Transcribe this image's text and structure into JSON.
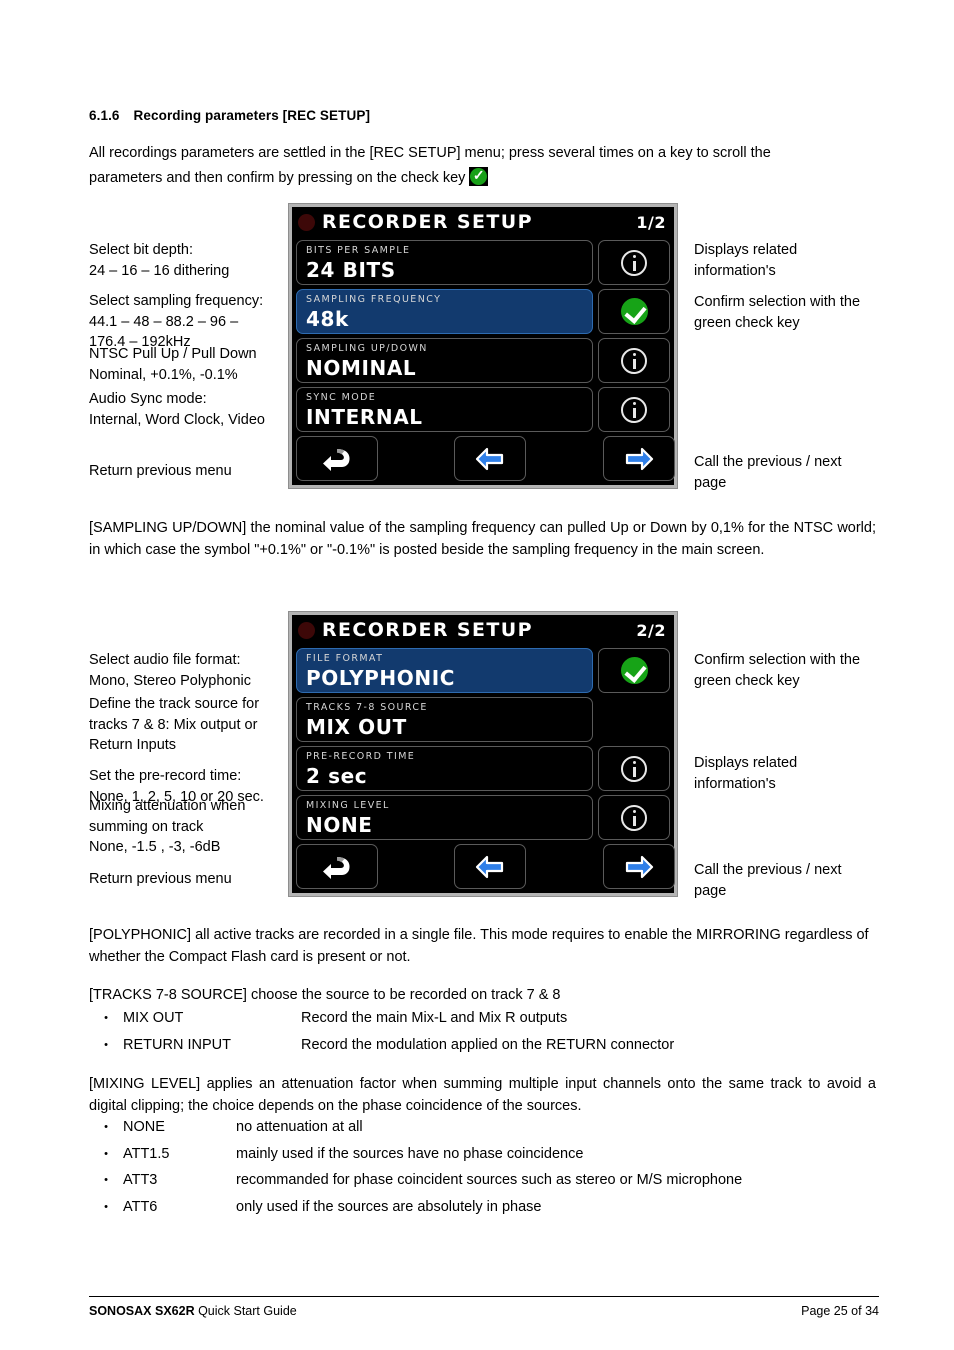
{
  "section": {
    "number": "6.1.6",
    "title": "Recording parameters [REC SETUP]"
  },
  "intro": {
    "line1": "All recordings parameters are settled in the [REC SETUP] menu; press several times on a key to scroll the",
    "line2": "parameters and then confirm by pressing on the check key",
    "check_icon": "green-check-icon"
  },
  "screen1": {
    "title": "RECORDER SETUP",
    "page_indicator": "1/2",
    "rec_dot": "record-dot-icon",
    "rows": [
      {
        "label": "BITS PER SAMPLE",
        "value": "24 BITS",
        "selected": false,
        "button": "info"
      },
      {
        "label": "SAMPLING FREQUENCY",
        "value": "48k",
        "selected": true,
        "button": "check"
      },
      {
        "label": "SAMPLING UP/DOWN",
        "value": "NOMINAL",
        "selected": false,
        "button": "info"
      },
      {
        "label": "SYNC MODE",
        "value": "INTERNAL",
        "selected": false,
        "button": "info"
      }
    ],
    "nav": {
      "return": "return-arrow-icon",
      "prev": "left-arrow-icon",
      "next": "right-arrow-icon"
    },
    "left_notes": [
      "Select bit depth:\n24 – 16 – 16 dithering",
      "Select sampling frequency:\n44.1 – 48 – 88.2 – 96 –\n176.4 – 192kHz",
      "NTSC Pull Up / Pull Down\nNominal, +0.1%, -0.1%",
      "Audio Sync mode:\nInternal, Word Clock, Video",
      "Return previous menu"
    ],
    "right_notes": [
      "Displays related\ninformation's",
      "Confirm selection with the\ngreen check key",
      "Call the previous /  next\npage"
    ]
  },
  "middle_paragraph": "[SAMPLING UP/DOWN] the nominal value of the sampling frequency can pulled Up or Down by 0,1% for the NTSC world; in which case the symbol \"+0.1%\" or \"-0.1%\" is posted beside the sampling frequency in the main screen.",
  "screen2": {
    "title": "RECORDER SETUP",
    "page_indicator": "2/2",
    "rec_dot": "record-dot-icon",
    "rows": [
      {
        "label": "FILE FORMAT",
        "value": "POLYPHONIC",
        "selected": true,
        "button": "check"
      },
      {
        "label": "TRACKS 7-8 SOURCE",
        "value": "MIX OUT",
        "selected": false,
        "button": "none"
      },
      {
        "label": "PRE-RECORD TIME",
        "value": "2 sec",
        "selected": false,
        "button": "info"
      },
      {
        "label": "MIXING LEVEL",
        "value": "NONE",
        "selected": false,
        "button": "info"
      }
    ],
    "nav": {
      "return": "return-arrow-icon",
      "prev": "left-arrow-icon",
      "next": "right-arrow-icon"
    },
    "left_notes": [
      "Select audio file format:\nMono, Stereo Polyphonic",
      "Define the track source for\ntracks 7 & 8: Mix output or\nReturn Inputs",
      "Set the pre-record time:\nNone, 1, 2, 5, 10 or 20 sec.",
      "Mixing attenuation when\nsumming on track\nNone, -1.5 , -3,  -6dB",
      "Return previous menu"
    ],
    "right_notes": [
      "Confirm selection with the\ngreen check key",
      "Displays related\ninformation's",
      "Call the previous /  next\npage"
    ]
  },
  "polyphonic_paragraph": "[POLYPHONIC] all active tracks are recorded in a single file. This mode requires to enable the MIRRORING regardless of whether the Compact Flash card is present or not.",
  "tracks_section": {
    "intro": "[TRACKS 7-8 SOURCE] choose the source to be recorded on track 7 & 8",
    "items": [
      {
        "term": "MIX OUT",
        "desc": "Record the main Mix-L and Mix R outputs"
      },
      {
        "term": "RETURN INPUT",
        "desc": "Record the modulation applied on the RETURN connector"
      }
    ]
  },
  "mixing_section": {
    "intro": "[MIXING LEVEL] applies an attenuation factor when summing multiple input channels onto the same track to avoid a digital clipping; the choice depends on the phase coincidence of the sources.",
    "items": [
      {
        "term": "NONE",
        "desc": "no attenuation at all"
      },
      {
        "term": "ATT1.5",
        "desc": "mainly used if the sources have no phase coincidence"
      },
      {
        "term": "ATT3",
        "desc": "recommanded for phase coincident sources such as stereo or M/S microphone"
      },
      {
        "term": "ATT6",
        "desc": "only used if the sources are absolutely in phase"
      }
    ]
  },
  "footer": {
    "brand": "SONOSAX  SX62R",
    "guide": " Quick Start Guide",
    "page": "Page 25 of 34"
  },
  "colors": {
    "title_bar": "#102c52",
    "selected_row": "#123a6e",
    "check_green": "#17a317",
    "arrow_blue": "#2f7fe8",
    "rec_dot": "#3d0808"
  }
}
